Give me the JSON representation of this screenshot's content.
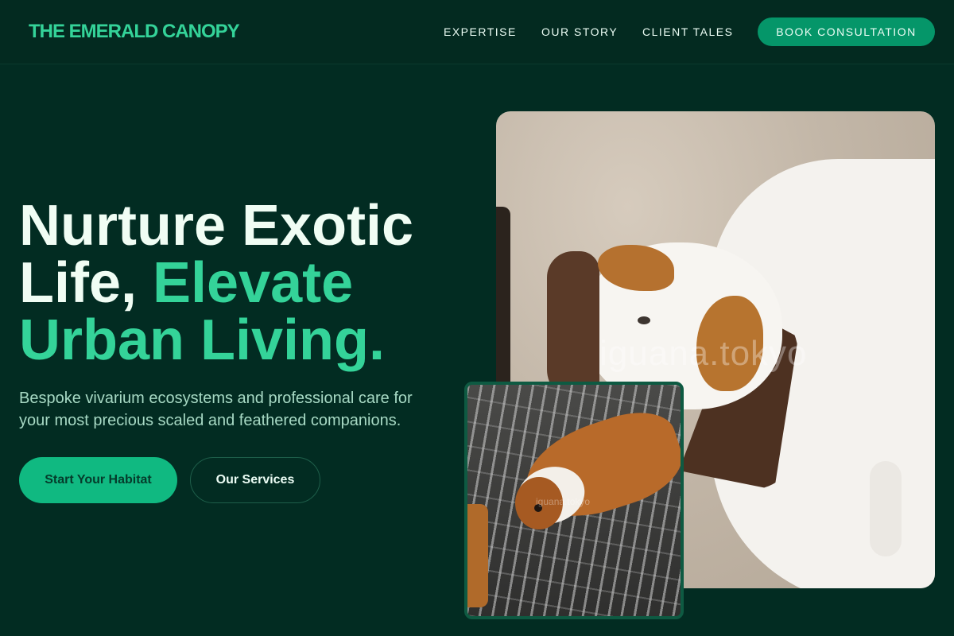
{
  "brand": "THE EMERALD CANOPY",
  "nav": {
    "items": [
      "EXPERTISE",
      "OUR STORY",
      "CLIENT TALES"
    ],
    "cta": "BOOK CONSULTATION"
  },
  "hero": {
    "title_line1": "Nurture Exotic",
    "title_line2_plain": "Life, ",
    "title_line2_accent": "Elevate",
    "title_line3": "Urban Living.",
    "subtitle": "Bespoke vivarium ecosystems and professional care for your most precious scaled and feathered companions.",
    "primary_button": "Start Your Habitat",
    "secondary_button": "Our Services"
  },
  "images": {
    "main_watermark": "iguana.tokyo",
    "inset_watermark": "iguana.tokyo"
  },
  "colors": {
    "background": "#022c22",
    "accent": "#34d399",
    "button_primary": "#10b981",
    "nav_cta": "#059669"
  }
}
